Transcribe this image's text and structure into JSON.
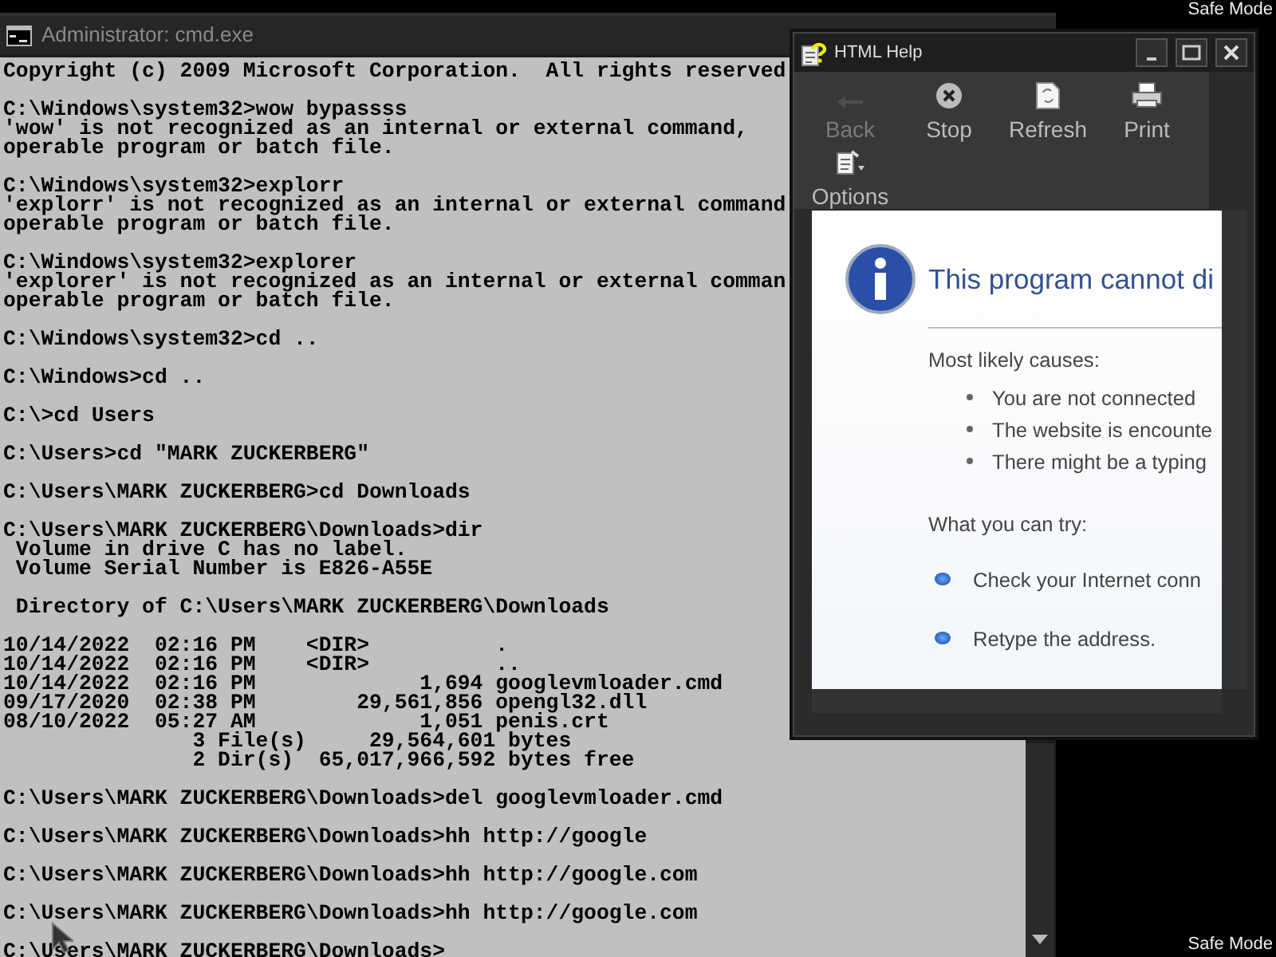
{
  "desktop": {
    "labels": [
      "Safe Mode",
      "Safe Mode"
    ]
  },
  "cmd_window": {
    "title": "Administrator: cmd.exe",
    "blocks": [
      [
        "Copyright (c) 2009 Microsoft Corporation.  All rights reserved"
      ],
      [
        "C:\\Windows\\system32>wow bypassss",
        "'wow' is not recognized as an internal or external command,",
        "operable program or batch file."
      ],
      [
        "C:\\Windows\\system32>explorr",
        "'explorr' is not recognized as an internal or external command",
        "operable program or batch file."
      ],
      [
        "C:\\Windows\\system32>explorer",
        "'explorer' is not recognized as an internal or external comman",
        "operable program or batch file."
      ],
      [
        "C:\\Windows\\system32>cd .."
      ],
      [
        "C:\\Windows>cd .."
      ],
      [
        "C:\\>cd Users"
      ],
      [
        "C:\\Users>cd \"MARK ZUCKERBERG\""
      ],
      [
        "C:\\Users\\MARK ZUCKERBERG>cd Downloads"
      ],
      [
        "C:\\Users\\MARK ZUCKERBERG\\Downloads>dir",
        " Volume in drive C has no label.",
        " Volume Serial Number is E826-A55E"
      ],
      [
        " Directory of C:\\Users\\MARK ZUCKERBERG\\Downloads"
      ],
      [
        "10/14/2022  02:16 PM    <DIR>          .",
        "10/14/2022  02:16 PM    <DIR>          ..",
        "10/14/2022  02:16 PM             1,694 googlevmloader.cmd",
        "09/17/2020  02:38 PM        29,561,856 opengl32.dll",
        "08/10/2022  05:27 AM             1,051 penis.crt",
        "               3 File(s)     29,564,601 bytes",
        "               2 Dir(s)  65,017,966,592 bytes free"
      ],
      [
        "C:\\Users\\MARK ZUCKERBERG\\Downloads>del googlevmloader.cmd"
      ],
      [
        "C:\\Users\\MARK ZUCKERBERG\\Downloads>hh http://google"
      ],
      [
        "C:\\Users\\MARK ZUCKERBERG\\Downloads>hh http://google.com"
      ],
      [
        "C:\\Users\\MARK ZUCKERBERG\\Downloads>hh http://google.com"
      ],
      [
        "C:\\Users\\MARK ZUCKERBERG\\Downloads>"
      ]
    ]
  },
  "help_window": {
    "title": "HTML Help",
    "toolbar": [
      {
        "label": "Back",
        "disabled": true
      },
      {
        "label": "Stop",
        "disabled": false
      },
      {
        "label": "Refresh",
        "disabled": false
      },
      {
        "label": "Print",
        "disabled": false
      },
      {
        "label": "Options",
        "disabled": false
      }
    ],
    "page": {
      "heading": "This program cannot di",
      "causes_heading": "Most likely causes:",
      "causes": [
        "You are not connected",
        "The website is encounte",
        "There might be a typing"
      ],
      "try_heading": "What you can try:",
      "tries": [
        "Check your Internet conn",
        "Retype the address."
      ]
    }
  }
}
